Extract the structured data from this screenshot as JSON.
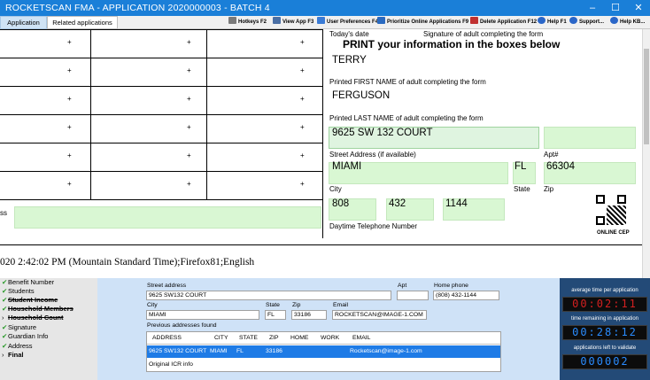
{
  "window": {
    "title": "ROCKETSCAN FMA - APPLICATION 2020000003 - BATCH 4",
    "min_glyph": "–",
    "max_glyph": "☐",
    "close_glyph": "✕"
  },
  "tabs": [
    "Application",
    "Related applications"
  ],
  "toolbar": [
    {
      "label": "Hotkeys F2",
      "icon": "keyboard-icon",
      "color": "#7a7a7a"
    },
    {
      "label": "View App F3",
      "icon": "document-icon",
      "color": "#4a6fa5"
    },
    {
      "label": "User Preferences F4",
      "icon": "people-icon",
      "color": "#3a7bd5"
    },
    {
      "label": "Prioritize Online Applications F9",
      "icon": "computer-icon",
      "color": "#2a6ac0"
    },
    {
      "label": "Delete Application F12",
      "icon": "delete-icon",
      "color": "#c03030"
    },
    {
      "label": "Help F1",
      "icon": "help-icon",
      "color": "#2a66c8"
    },
    {
      "label": "Support...",
      "icon": "support-icon",
      "color": "#2a66c8"
    },
    {
      "label": "Help KB...",
      "icon": "knowledge-base-icon",
      "color": "#2a66c8"
    }
  ],
  "document": {
    "plus": "+",
    "left_label_fragment": "ss",
    "footer_text": "020 2:42:02 PM (Mountain Standard Time);Firefox81;English",
    "todays_date_label": "Today's date",
    "signature_label": "Signature of adult completing the form",
    "print_heading": "PRINT your information in the boxes below",
    "first_name_value": "TERRY",
    "first_name_label": "Printed FIRST NAME of adult completing the form",
    "last_name_value": "FERGUSON",
    "last_name_label": "Printed LAST NAME of adult completing the form",
    "street_value": "9625 SW 132 COURT",
    "street_label": "Street Address (if available)",
    "apt_label": "Apt#",
    "city_value": "MIAMI",
    "state_value": "FL",
    "zip_value": "66304",
    "city_label": "City",
    "state_label": "State",
    "zip_label": "Zip",
    "phone_area": "808",
    "phone_prefix": "432",
    "phone_line": "1144",
    "phone_label": "Daytime Telephone Number",
    "online_cep_label": "ONLINE CEP"
  },
  "checklist": [
    {
      "label": "Benefit Number",
      "checked": true,
      "style": "normal"
    },
    {
      "label": "Students",
      "checked": true,
      "style": "normal"
    },
    {
      "label": "Student Income",
      "checked": true,
      "style": "strike"
    },
    {
      "label": "Household Members",
      "checked": true,
      "style": "strike"
    },
    {
      "label": "Household Count",
      "checked": false,
      "style": "strike"
    },
    {
      "label": "Signature",
      "checked": true,
      "style": "normal"
    },
    {
      "label": "Guardian Info",
      "checked": true,
      "style": "normal"
    },
    {
      "label": "Address",
      "checked": true,
      "style": "normal"
    },
    {
      "label": "Final",
      "checked": false,
      "style": "bold"
    }
  ],
  "address_form": {
    "street_label": "Street address",
    "street_value": "9625 SW132 COURT",
    "apt_label": "Apt",
    "apt_value": "",
    "phone_label": "Home phone",
    "phone_value": "(808) 432-1144",
    "city_label": "City",
    "city_value": "MIAMI",
    "state_label": "State",
    "state_value": "FL",
    "zip_label": "Zip",
    "zip_value": "33186",
    "email_label": "Email",
    "email_value": "ROCKETSCAN@IMAGE-1.COM",
    "previous_label": "Previous addresses found",
    "columns": [
      "ADDRESS",
      "CITY",
      "STATE",
      "ZIP",
      "HOME",
      "WORK",
      "EMAIL"
    ],
    "rows": [
      [
        "9625 SW132 COURT",
        "MIAMI",
        "FL",
        "33186",
        "",
        "",
        "Rocketscan@image-1.com"
      ]
    ],
    "original_icr": "Original ICR info"
  },
  "stats": {
    "avg_label": "average time per application",
    "avg_value": "00:02:11",
    "remaining_label": "time remaining in application",
    "remaining_value": "00:28:12",
    "left_label": "applications left to validate",
    "left_value": "000002"
  }
}
